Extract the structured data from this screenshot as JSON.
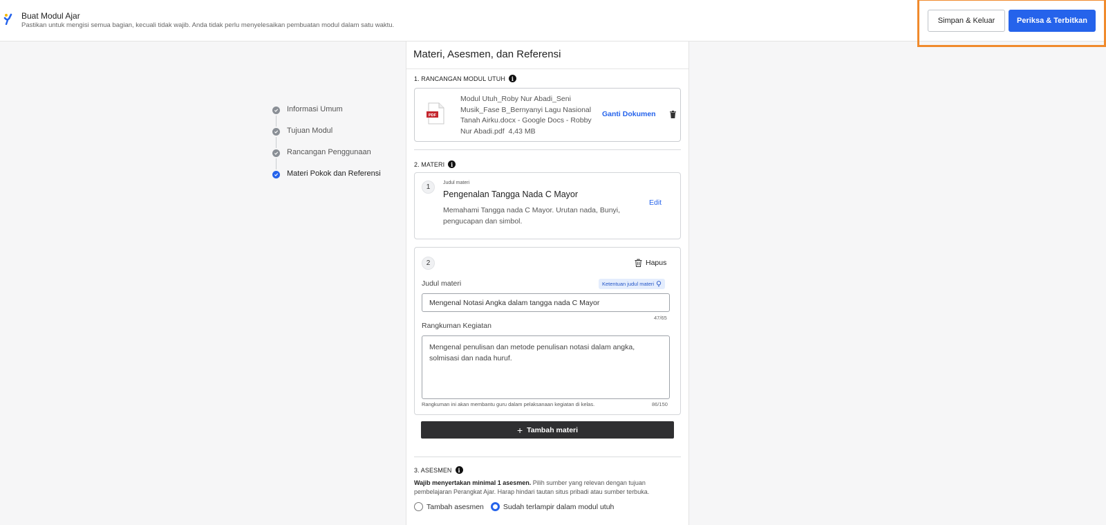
{
  "header": {
    "title": "Buat Modul Ajar",
    "subtitle": "Pastikan untuk mengisi semua bagian, kecuali tidak wajib. Anda tidak perlu menyelesaikan pembuatan modul dalam satu waktu.",
    "save_label": "Simpan & Keluar",
    "publish_label": "Periksa & Terbitkan",
    "accent": "#2563eb",
    "highlight_color": "#f08a2c"
  },
  "stepper": {
    "steps": [
      {
        "label": "Informasi Umum",
        "state": "done"
      },
      {
        "label": "Tujuan Modul",
        "state": "done"
      },
      {
        "label": "Rancangan Penggunaan",
        "state": "done"
      },
      {
        "label": "Materi Pokok dan Referensi",
        "state": "active"
      }
    ]
  },
  "main": {
    "title": "Materi, Asesmen, dan Referensi",
    "sections": {
      "rancangan": {
        "label": "1. RANCANGAN MODUL UTUH",
        "pdf_badge": "PDF",
        "file_name": "Modul Utuh_Roby Nur Abadi_Seni Musik_Fase B_Bernyanyi Lagu Nasional Tanah Airku.docx - Google Docs - Robby Nur Abadi.pdf",
        "file_size": "4,43 MB",
        "replace_label": "Ganti Dokumen"
      },
      "materi": {
        "label": "2. MATERI",
        "item1": {
          "number": "1",
          "small_label": "Judul materi",
          "title": "Pengenalan Tangga Nada C Mayor",
          "description": "Memahami Tangga nada C Mayor. Urutan nada, Bunyi, pengucapan dan simbol.",
          "edit_label": "Edit"
        },
        "item2": {
          "number": "2",
          "delete_label": "Hapus",
          "title_label": "Judul materi",
          "hint_label": "Ketentuan judul materi",
          "title_value": "Mengenal Notasi Angka dalam tangga nada C Mayor",
          "title_counter": "47/65",
          "summary_label": "Rangkuman Kegiatan",
          "summary_value": "Mengenal penulisan dan metode penulisan notasi dalam angka, solmisasi dan nada huruf.",
          "summary_help": "Rangkuman ini akan membantu guru dalam pelaksanaan kegiatan di kelas.",
          "summary_counter": "86/150"
        },
        "add_label": "Tambah materi"
      },
      "asesmen": {
        "label": "3. ASESMEN",
        "desc_bold": "Wajib menyertakan minimal 1 asesmen.",
        "desc_rest": " Pilih sumber yang relevan dengan tujuan pembelajaran Perangkat Ajar. Harap hindari tautan situs pribadi atau sumber terbuka.",
        "option1": "Tambah asesmen",
        "option2": "Sudah terlampir dalam modul utuh",
        "selected": "option2"
      }
    }
  }
}
